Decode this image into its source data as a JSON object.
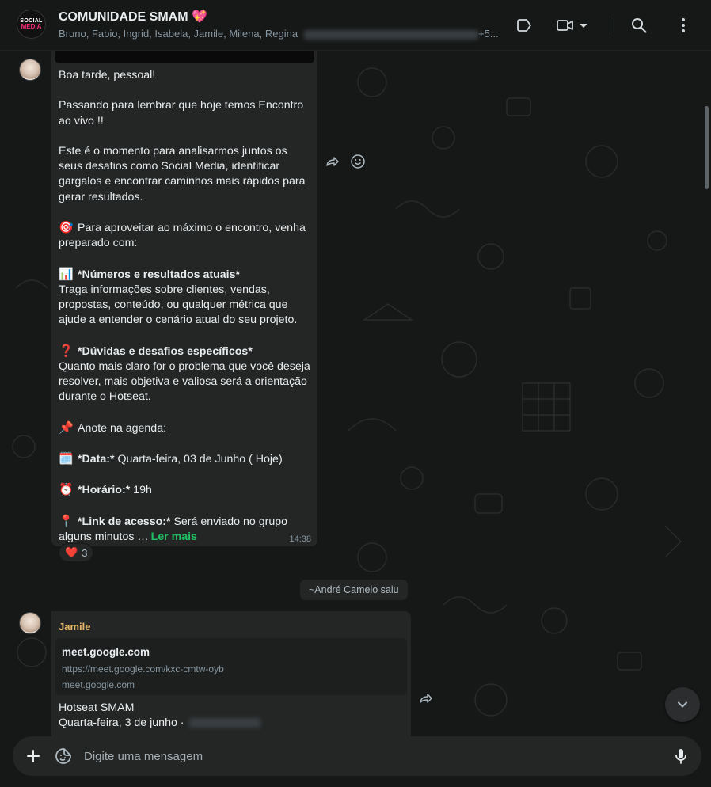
{
  "header": {
    "avatar_line1": "SOCIAL",
    "avatar_line2": "MEDIA",
    "title": "COMUNIDADE SMAM 💖",
    "participants": "Bruno, Fabio, Ingrid, Isabela, Jamile, Milena, Regina",
    "participants_tail": "+5...",
    "icons": [
      "label-icon",
      "video-call-icon",
      "chevron-down-icon",
      "search-icon",
      "menu-icon"
    ]
  },
  "message1": {
    "lines": [
      "Boa tarde, pessoal!",
      "",
      "Passando para lembrar que hoje temos Encontro",
      "ao vivo !!",
      "",
      "Este é o momento para analisarmos juntos os",
      "seus desafios como Social Media, identificar",
      "gargalos e encontrar caminhos mais rápidos para",
      "gerar resultados.",
      ""
    ],
    "dart_line1": "Para aproveitar ao máximo o encontro, venha",
    "dart_line2": "preparado com:",
    "numbers_title": "*Números e resultados atuais*",
    "numbers_lines": [
      "Traga informações sobre clientes, vendas,",
      "propostas, conteúdo, ou qualquer métrica que",
      "ajude a entender o cenário atual do seu projeto."
    ],
    "doubts_title": "*Dúvidas e desafios específicos*",
    "doubts_lines": [
      "Quanto mais claro for o problema que você deseja",
      "resolver, mais objetiva e valiosa será a orientação",
      "durante o Hotseat."
    ],
    "agenda": "Anote na agenda:",
    "date_label": "*Data:*",
    "date_value": " Quarta-feira, 03 de Junho ( Hoje)",
    "time_label": "*Horário:*",
    "time_value": " 19h",
    "link_label": "*Link de acesso:*",
    "link_value": " Será enviado no grupo",
    "last_line": "alguns minutos …",
    "read_more": "Ler mais",
    "timestamp": "14:38",
    "reaction_emoji": "❤️",
    "reaction_count": "3"
  },
  "system_message": "~André Camelo saiu",
  "message2": {
    "sender": "Jamile",
    "link_title": "meet.google.com",
    "link_url": "https://meet.google.com/kxc-cmtw-oyb",
    "link_domain": "meet.google.com",
    "line1": "Hotseat SMAM",
    "line2": "Quarta-feira, 3 de junho ·"
  },
  "composer": {
    "placeholder": "Digite uma mensagem"
  },
  "colors": {
    "background": "#161717",
    "bubble": "#242626",
    "accent": "#21c063",
    "sender": "#e8b969"
  }
}
